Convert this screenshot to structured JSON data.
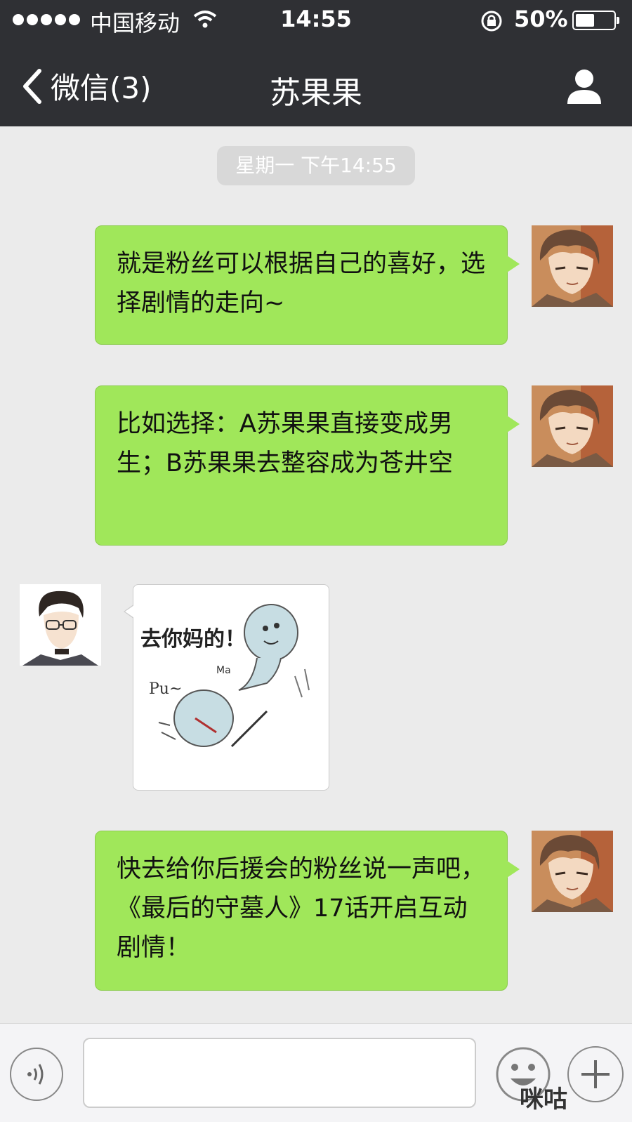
{
  "status_bar": {
    "carrier": "中国移动",
    "time": "14:55",
    "battery": "50%",
    "battery_level": 0.5
  },
  "navbar": {
    "back_label": "微信(3)",
    "title": "苏果果"
  },
  "timestamp": "星期一 下午14:55",
  "messages": [
    {
      "sender": "self",
      "text": "就是粉丝可以根据自己的喜好，选择剧情的走向~"
    },
    {
      "sender": "self",
      "text": "比如选择：A苏果果直接变成男生；B苏果果去整容成为苍井空"
    },
    {
      "sender": "other",
      "sticker_text": "去你妈的！",
      "sticker_sub1": "Pu~",
      "sticker_sub2": "Ma"
    },
    {
      "sender": "self",
      "text": "快去给你后援会的粉丝说一声吧，《最后的守墓人》17话开启互动剧情！"
    }
  ],
  "input_bar": {
    "icons": [
      "voice-icon",
      "emoji-icon",
      "plus-icon"
    ]
  },
  "watermark": "咪咕",
  "colors": {
    "bubble": "#a0e75a",
    "header": "#2f3034",
    "background": "#ebebeb"
  }
}
